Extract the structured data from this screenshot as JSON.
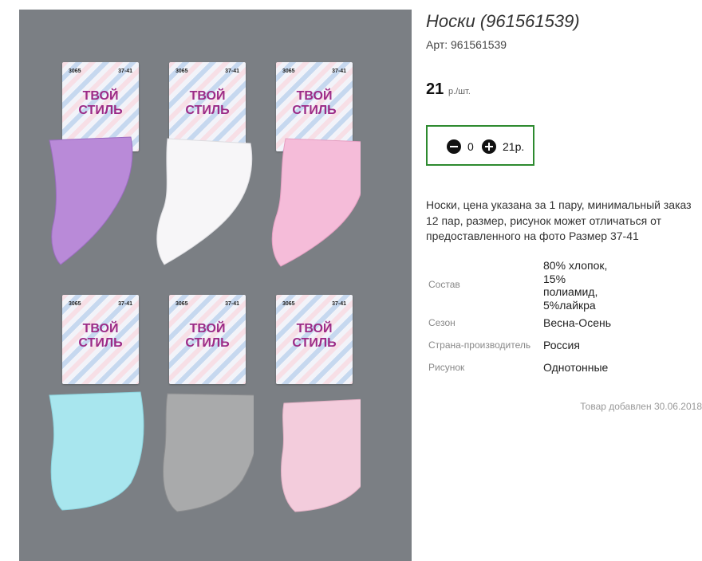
{
  "product": {
    "title": "Носки (961561539)",
    "article": "Арт: 961561539",
    "price_value": "21",
    "price_unit": "р./шт.",
    "quantity": "0",
    "total": "21р.",
    "description": "Носки, цена указана за 1 пару, минимальный заказ 12 пар, размер, рисунок может отличаться от предоставленного на фото Размер 37-41",
    "added": "Товар добавлен 30.06.2018"
  },
  "properties": [
    {
      "label": "Состав",
      "value": [
        "80% хлопок,",
        "15%",
        "полиамид,",
        "5%лайкра"
      ]
    },
    {
      "label": "Сезон",
      "value": [
        "Весна-Осень"
      ]
    },
    {
      "label": "Страна-производитель",
      "value": [
        "Россия"
      ]
    },
    {
      "label": "Рисунок",
      "value": [
        "Однотонные"
      ]
    }
  ],
  "photo": {
    "packs": [
      {
        "code": "3065",
        "size": "37-41",
        "brand": [
          "ТВОЙ",
          "СТИЛЬ"
        ],
        "color": "#b98ad8"
      },
      {
        "code": "3065",
        "size": "37-41",
        "brand": [
          "ТВОЙ",
          "СТИЛЬ"
        ],
        "color": "#f7f6f8"
      },
      {
        "code": "3065",
        "size": "37-41",
        "brand": [
          "ТВОЙ",
          "СТИЛЬ"
        ],
        "color": "#f5bcd9"
      },
      {
        "code": "3065",
        "size": "37-41",
        "brand": [
          "ТВОЙ",
          "СТИЛЬ"
        ],
        "color": "#a8e6ee"
      },
      {
        "code": "3065",
        "size": "37-41",
        "brand": [
          "ТВОЙ",
          "СТИЛЬ"
        ],
        "color": "#a9aaab"
      },
      {
        "code": "3065",
        "size": "37-41",
        "brand": [
          "ТВОЙ",
          "СТИЛЬ"
        ],
        "color": "#f3ccdc"
      }
    ]
  },
  "colors": {
    "accent_border": "#2d8a2f",
    "photo_bg": "#7b7f84",
    "brand_text": "#9c2b87"
  }
}
